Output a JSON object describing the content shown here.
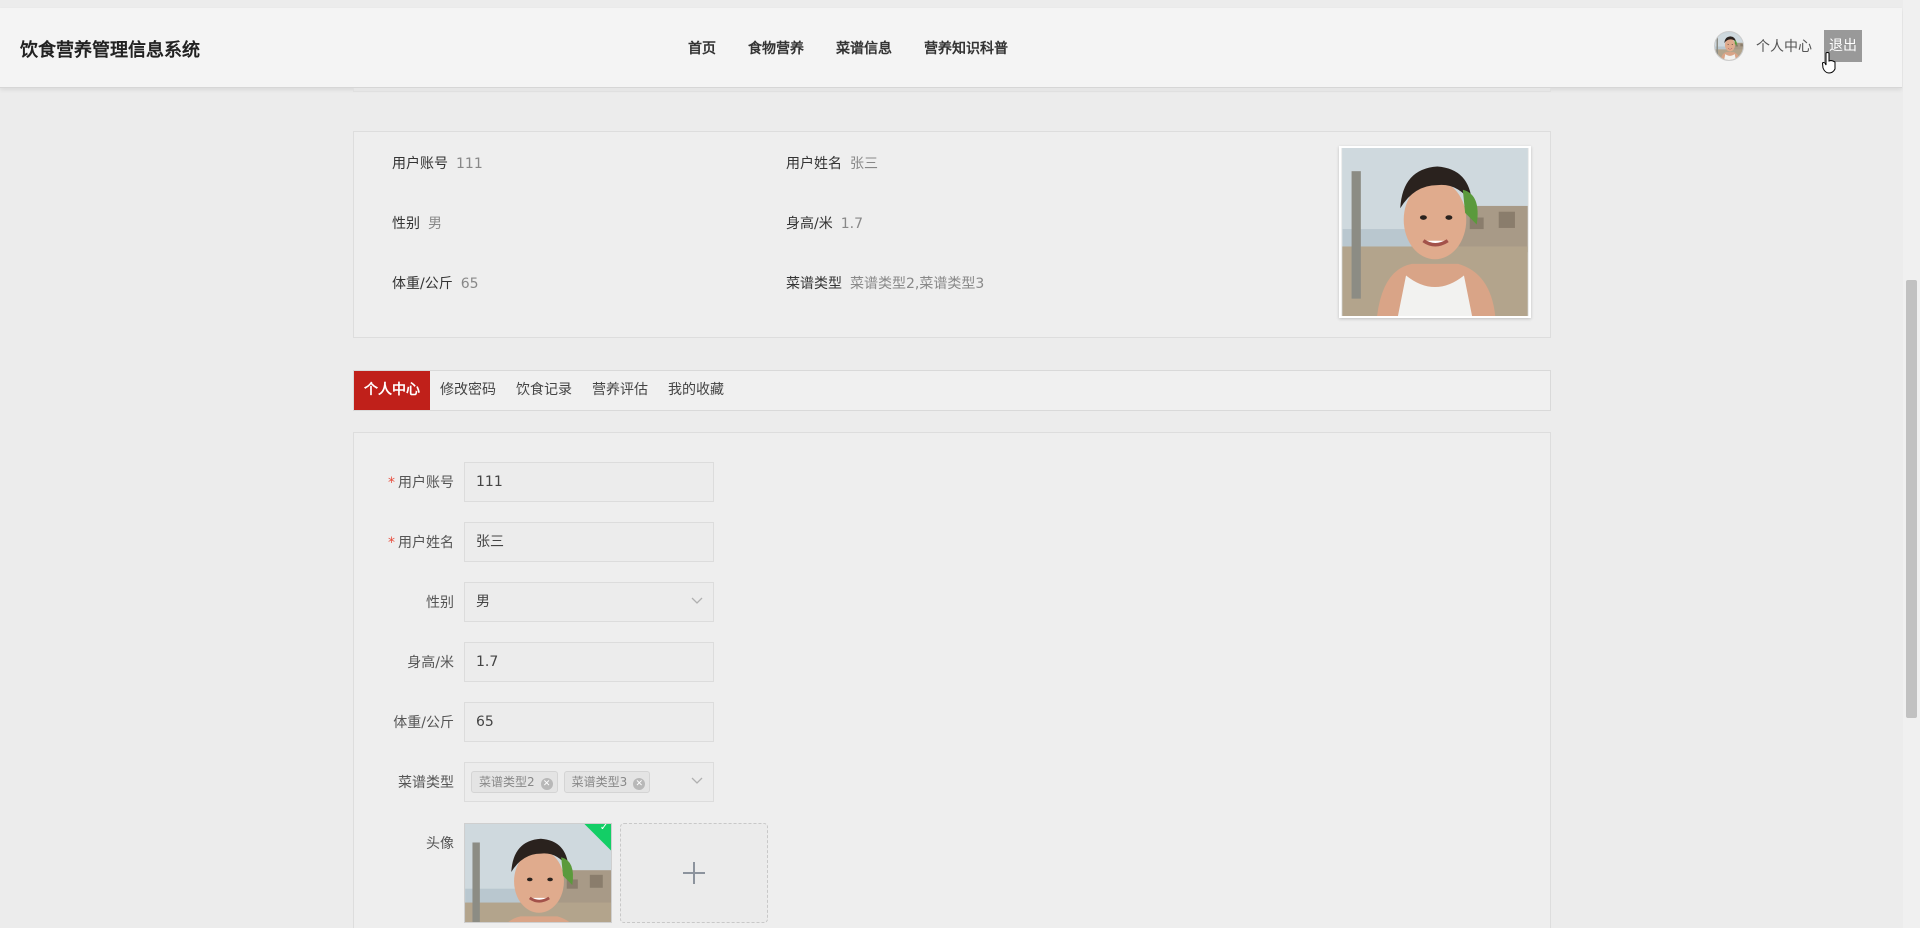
{
  "header": {
    "brand": "饮食营养管理信息系统",
    "nav": [
      "首页",
      "食物营养",
      "菜谱信息",
      "营养知识科普"
    ],
    "user_center": "个人中心",
    "logout": "退出"
  },
  "profile": {
    "account_label": "用户账号",
    "account_value": "111",
    "name_label": "用户姓名",
    "name_value": "张三",
    "gender_label": "性别",
    "gender_value": "男",
    "height_label": "身高/米",
    "height_value": "1.7",
    "weight_label": "体重/公斤",
    "weight_value": "65",
    "recipe_label": "菜谱类型",
    "recipe_value": "菜谱类型2,菜谱类型3"
  },
  "tabs": [
    "个人中心",
    "修改密码",
    "饮食记录",
    "营养评估",
    "我的收藏"
  ],
  "form": {
    "required_mark": "*",
    "account_label": "用户账号",
    "account_value": "111",
    "name_label": "用户姓名",
    "name_value": "张三",
    "gender_label": "性别",
    "gender_value": "男",
    "height_label": "身高/米",
    "height_value": "1.7",
    "weight_label": "体重/公斤",
    "weight_value": "65",
    "recipe_label": "菜谱类型",
    "recipe_tags": [
      "菜谱类型2",
      "菜谱类型3"
    ],
    "avatar_label": "头像"
  },
  "colors": {
    "accent_red": "#c0201a",
    "success_green": "#13ce66"
  }
}
